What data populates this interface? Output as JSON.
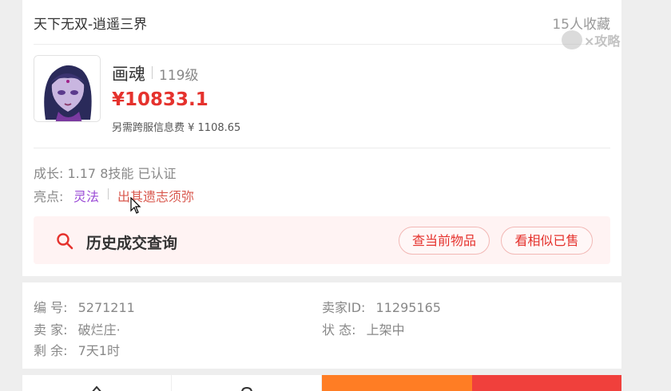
{
  "listing": {
    "server": "天下无双-逍遥三界",
    "favorites": "15人收藏",
    "character_name": "画魂",
    "level": "119级",
    "price": "¥10833.1",
    "extra_fee": "另需跨服信息费 ¥ 1108.65",
    "attributes": "成长: 1.17 8技能 已认证",
    "highlights_label": "亮点:",
    "highlights": [
      "灵法",
      "出其遗志须弥"
    ]
  },
  "history": {
    "title": "历史成交查询",
    "btn_current": "查当前物品",
    "btn_similar": "看相似已售"
  },
  "info": {
    "id_label": "编 号:",
    "id_value": "5271211",
    "seller_id_label": "卖家ID:",
    "seller_id_value": "11295165",
    "seller_label": "卖 家:",
    "seller_value": "破烂庄·",
    "status_label": "状 态:",
    "status_value": "上架中",
    "remaining_label": "剩 余:",
    "remaining_value": "7天1时"
  },
  "watermark": {
    "text": "×攻略"
  },
  "colors": {
    "price_red": "#e5322d",
    "highlight_purple": "#9b4bd6",
    "highlight_red": "#d9584e",
    "buy_orange": "#ff7d24",
    "buy_red": "#f0403c"
  },
  "icons": [
    "search-icon",
    "home-icon",
    "chat-icon",
    "cursor-icon"
  ]
}
